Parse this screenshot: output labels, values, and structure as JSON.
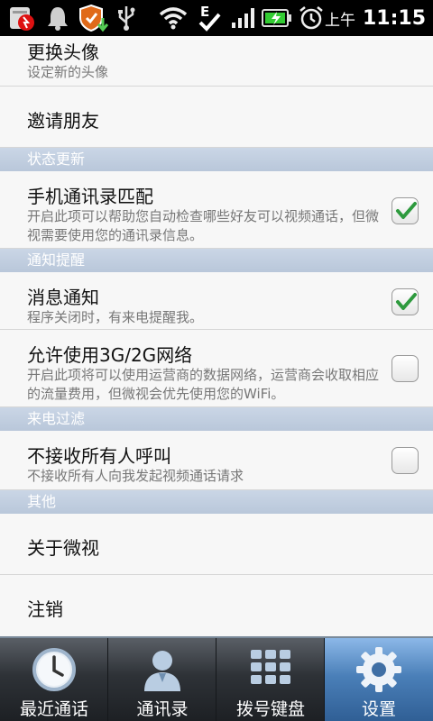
{
  "status_bar": {
    "ampm": "上午",
    "time": "11:15",
    "data_indicator": "E"
  },
  "settings": {
    "change_avatar": {
      "title": "更换头像",
      "subtitle": "设定新的头像"
    },
    "invite_friends": {
      "title": "邀请朋友"
    },
    "section_status": "状态更新",
    "contacts_match": {
      "title": "手机通讯录匹配",
      "subtitle": "开启此项可以帮助您自动检查哪些好友可以视频通话，但微视需要使用您的通讯录信息。",
      "checked": true
    },
    "section_notify": "通知提醒",
    "message_notify": {
      "title": "消息通知",
      "subtitle": "程序关闭时，有来电提醒我。",
      "checked": true
    },
    "allow_network": {
      "title": "允许使用3G/2G网络",
      "subtitle": "开启此项将可以使用运营商的数据网络，运营商会收取相应的流量费用，但微视会优先使用您的WiFi。",
      "checked": false
    },
    "section_filter": "来电过滤",
    "reject_all": {
      "title": "不接收所有人呼叫",
      "subtitle": "不接收所有人向我发起视频通话请求",
      "checked": false
    },
    "section_other": "其他",
    "about": {
      "title": "关于微视"
    },
    "logout": {
      "title": "注销"
    }
  },
  "tabs": [
    {
      "label": "最近通话",
      "icon": "clock-icon",
      "active": false
    },
    {
      "label": "通讯录",
      "icon": "contact-icon",
      "active": false
    },
    {
      "label": "拨号键盘",
      "icon": "dialpad-icon",
      "active": false
    },
    {
      "label": "设置",
      "icon": "gear-icon",
      "active": true
    }
  ],
  "colors": {
    "section_header": "#c3d0e0",
    "check_green": "#2e9a3e",
    "active_tab": "#4a7fb8"
  }
}
